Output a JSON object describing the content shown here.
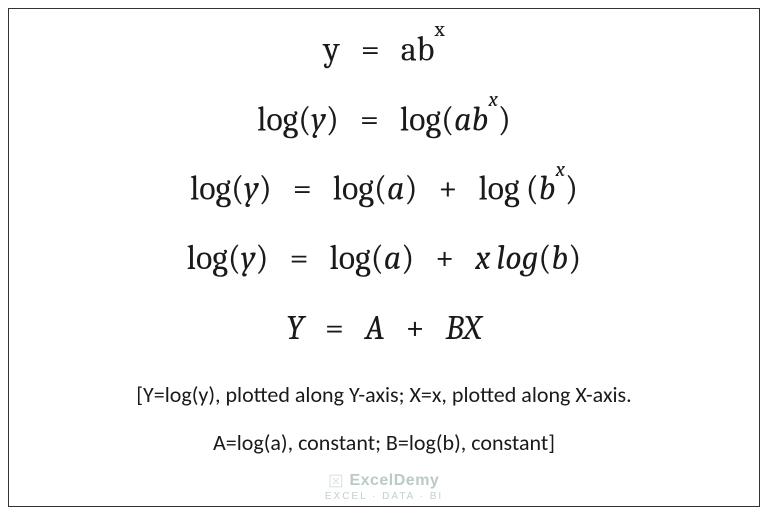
{
  "equations": {
    "e1": {
      "y": "y",
      "eq": "=",
      "a": "a",
      "b": "b",
      "x": "x"
    },
    "e2": {
      "log1": "log",
      "y": "y",
      "eq": "=",
      "log2": "log",
      "a": "a",
      "b": "b",
      "x": "x"
    },
    "e3": {
      "log1": "log",
      "y": "y",
      "eq": "=",
      "log2": "log",
      "a": "a",
      "plus": "+",
      "log3": "log",
      "b": "b",
      "x": "x"
    },
    "e4": {
      "log1": "log",
      "y": "y",
      "eq": "=",
      "log2": "log",
      "a": "a",
      "plus": "+",
      "xcoef": "x",
      "log3": "log",
      "b": "b"
    },
    "e5": {
      "Y": "Y",
      "eq": "=",
      "A": "A",
      "plus": "+",
      "B": "B",
      "X": "X"
    }
  },
  "notes": {
    "line1": "[Y=log(y), plotted along Y-axis; X=x, plotted along X-axis.",
    "line2": "A=log(a), constant; B=log(b), constant]"
  },
  "watermark": {
    "brand": "ExcelDemy",
    "tagline": "EXCEL · DATA · BI"
  }
}
